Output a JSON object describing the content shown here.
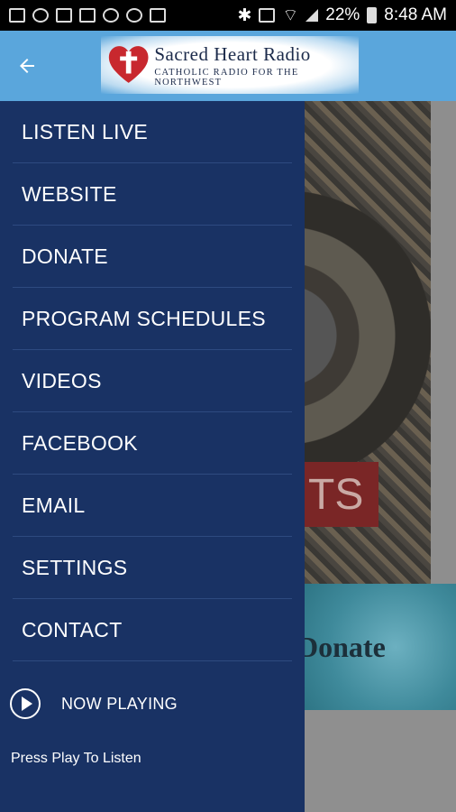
{
  "status_bar": {
    "battery": "22%",
    "time": "8:48 AM"
  },
  "header": {
    "logo_title": "Sacred Heart Radio",
    "logo_subtitle": "Catholic Radio For The Northwest"
  },
  "drawer": {
    "items": [
      {
        "label": "LISTEN LIVE"
      },
      {
        "label": "WEBSITE"
      },
      {
        "label": "DONATE"
      },
      {
        "label": "PROGRAM SCHEDULES"
      },
      {
        "label": "VIDEOS"
      },
      {
        "label": "FACEBOOK"
      },
      {
        "label": "EMAIL"
      },
      {
        "label": "SETTINGS"
      },
      {
        "label": "CONTACT"
      }
    ],
    "now_playing_label": "NOW PLAYING",
    "now_playing_status": "Press Play To Listen"
  },
  "background": {
    "art_text": "TS",
    "banner_text": "Donate"
  },
  "colors": {
    "drawer_bg": "#193264",
    "header_bg": "#5aa6dc"
  }
}
